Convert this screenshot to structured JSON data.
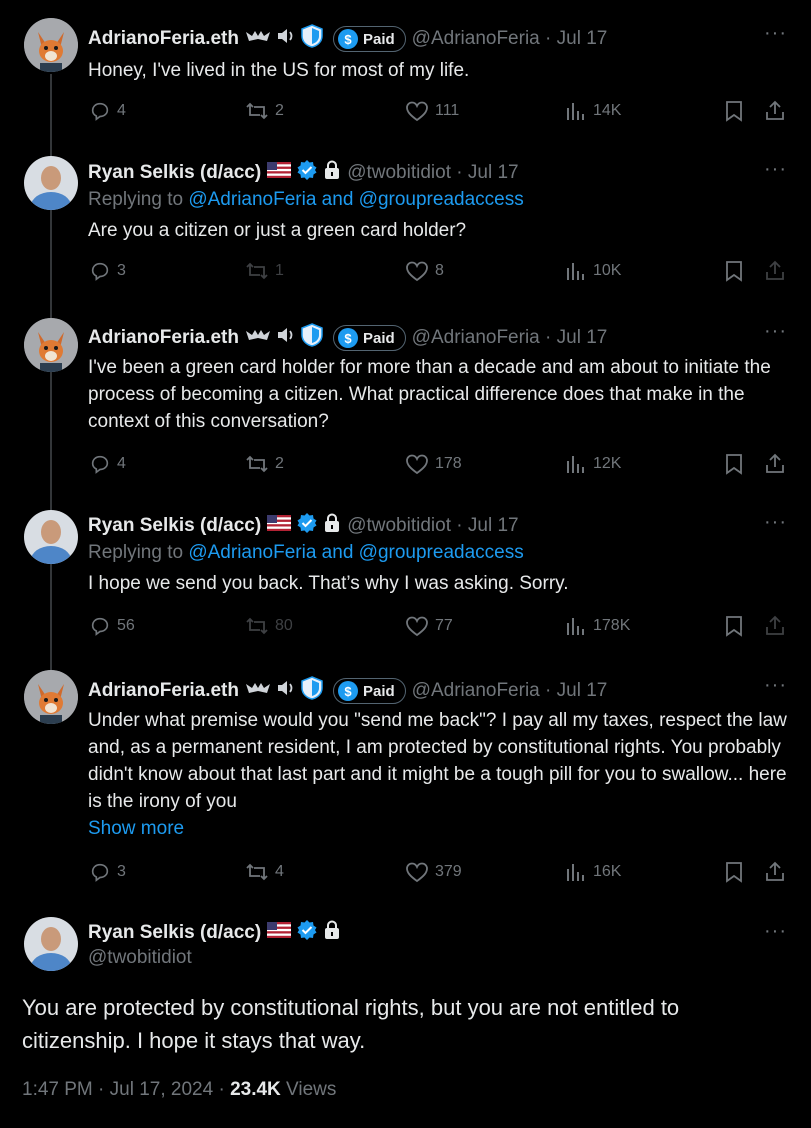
{
  "tweets": [
    {
      "author": "AdrianoFeria.eth",
      "handle": "@AdrianoFeria",
      "date": "Jul 17",
      "paid_label": "Paid",
      "text": "Honey, I've lived in the US for most of my life.",
      "replies": "4",
      "reposts": "2",
      "likes": "111",
      "views": "14K"
    },
    {
      "author": "Ryan Selkis (d/acc)",
      "handle": "@twobitidiot",
      "date": "Jul 17",
      "replying_prefix": "Replying to",
      "replying_targets": "@AdrianoFeria and @groupreadaccess",
      "text": "Are you a citizen or just a green card holder?",
      "replies": "3",
      "reposts": "1",
      "likes": "8",
      "views": "10K"
    },
    {
      "author": "AdrianoFeria.eth",
      "handle": "@AdrianoFeria",
      "date": "Jul 17",
      "paid_label": "Paid",
      "text": "I've been a green card holder for more than a decade and am about to initiate the process of becoming a citizen. What practical difference does that make in the context of this conversation?",
      "replies": "4",
      "reposts": "2",
      "likes": "178",
      "views": "12K"
    },
    {
      "author": "Ryan Selkis (d/acc)",
      "handle": "@twobitidiot",
      "date": "Jul 17",
      "replying_prefix": "Replying to",
      "replying_targets": "@AdrianoFeria and @groupreadaccess",
      "text": "I hope we send you back. That’s why I was asking. Sorry.",
      "replies": "56",
      "reposts": "80",
      "likes": "77",
      "views": "178K"
    },
    {
      "author": "AdrianoFeria.eth",
      "handle": "@AdrianoFeria",
      "date": "Jul 17",
      "paid_label": "Paid",
      "text": "Under what premise would you \"send me back\"? I pay all my taxes, respect the law and, as a permanent resident, I am protected by constitutional rights. You probably didn't know about that last part and it might be a tough pill for you to swallow... here is the irony of you",
      "show_more": "Show more",
      "replies": "3",
      "reposts": "4",
      "likes": "379",
      "views": "16K"
    }
  ],
  "focus_tweet": {
    "author": "Ryan Selkis (d/acc)",
    "handle": "@twobitidiot",
    "text": "You are protected by constitutional rights, but you are not entitled to citizenship. I hope it stays that way.",
    "timestamp": "1:47 PM · Jul 17, 2024 · ",
    "views_count": "23.4K",
    "views_label": " Views"
  },
  "date_separator": " · ",
  "more_glyph": "···",
  "colors": {
    "accent": "#1d9bf0",
    "muted": "#71767b",
    "text": "#e7e9ea",
    "background": "#000000"
  },
  "icons": [
    "reply-icon",
    "repost-icon",
    "like-icon",
    "views-icon",
    "bookmark-icon",
    "share-icon",
    "verified-icon",
    "lock-icon",
    "flag-us-icon",
    "shield-icon",
    "bat-icon",
    "speaker-icon"
  ]
}
